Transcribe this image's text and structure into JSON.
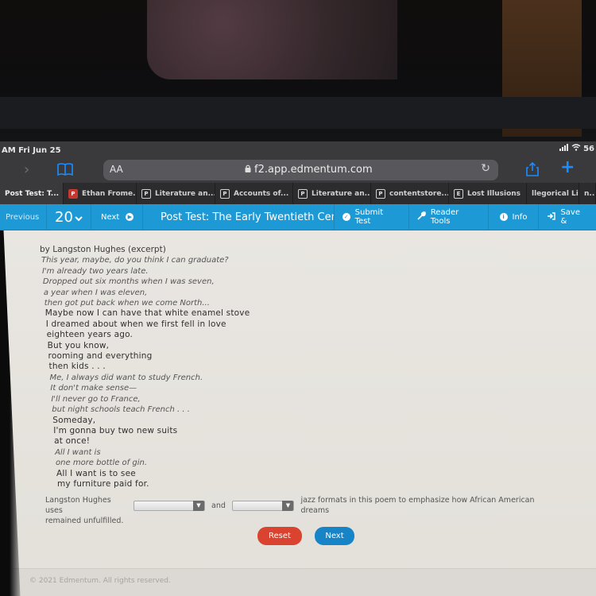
{
  "status_bar": {
    "time": "AM  Fri Jun 25",
    "battery": "56"
  },
  "browser": {
    "aa_label": "AA",
    "url": "f2.app.edmentum.com",
    "tabs": [
      {
        "label": "Post Test: T...",
        "icon": "none",
        "active": true
      },
      {
        "label": "Ethan Frome...",
        "icon": "pdf-icon"
      },
      {
        "label": "Literature an...",
        "icon": "P"
      },
      {
        "label": "Accounts of...",
        "icon": "P"
      },
      {
        "label": "Literature an...",
        "icon": "P"
      },
      {
        "label": "contentstore...",
        "icon": "P"
      },
      {
        "label": "Lost Illusions",
        "icon": "E"
      },
      {
        "label": "llegorical Li...",
        "icon": "none"
      },
      {
        "label": "n...",
        "icon": "none"
      }
    ]
  },
  "nav": {
    "previous": "Previous",
    "question_number": "20",
    "next": "Next",
    "title": "Post Test: The Early Twentieth Cent",
    "submit": "Submit Test",
    "reader_tools": "Reader Tools",
    "info": "Info",
    "save": "Save &"
  },
  "poem": {
    "byline": "by Langston Hughes (excerpt)",
    "lines": [
      {
        "text": "This year, maybe, do you think I can graduate?",
        "style": "it"
      },
      {
        "text": "I'm already two years late.",
        "style": "it"
      },
      {
        "text": "Dropped out six months when I was seven,",
        "style": "it"
      },
      {
        "text": "a year when I was eleven,",
        "style": "it"
      },
      {
        "text": "then got put back when we come North...",
        "style": "it"
      },
      {
        "text": "Maybe now I can have that white enamel stove",
        "style": "bd"
      },
      {
        "text": "I dreamed about when we first fell in love",
        "style": "bd"
      },
      {
        "text": "eighteen years ago.",
        "style": "bd"
      },
      {
        "text": "But you know,",
        "style": "bd"
      },
      {
        "text": "rooming and everything",
        "style": "bd"
      },
      {
        "text": "then kids . . .",
        "style": "bd"
      },
      {
        "text": "Me, I always did want to study French.",
        "style": "it"
      },
      {
        "text": "It don't make sense—",
        "style": "it"
      },
      {
        "text": "I'll never go to France,",
        "style": "it"
      },
      {
        "text": "but night schools teach French . . .",
        "style": "it"
      },
      {
        "text": "Someday,",
        "style": "bd"
      },
      {
        "text": "I'm gonna buy two new suits",
        "style": "bd"
      },
      {
        "text": "at once!",
        "style": "bd"
      },
      {
        "text": "All I want is",
        "style": "it"
      },
      {
        "text": "one more bottle of gin.",
        "style": "it"
      },
      {
        "text": "All I want is to see",
        "style": "bd"
      },
      {
        "text": "my furniture paid for.",
        "style": "bd"
      }
    ]
  },
  "question": {
    "prefix": "Langston Hughes uses",
    "connector": "and",
    "suffix": "jazz formats in this poem to emphasize how African American dreams",
    "line2": "remained unfulfilled.",
    "dropdown1_value": "",
    "dropdown2_value": ""
  },
  "buttons": {
    "reset": "Reset",
    "next": "Next"
  },
  "footer": {
    "copyright": "© 2021 Edmentum. All rights reserved."
  },
  "colors": {
    "nav_blue": "#1d9ad6",
    "reset_red": "#d9432f",
    "next_blue": "#1784c8"
  }
}
